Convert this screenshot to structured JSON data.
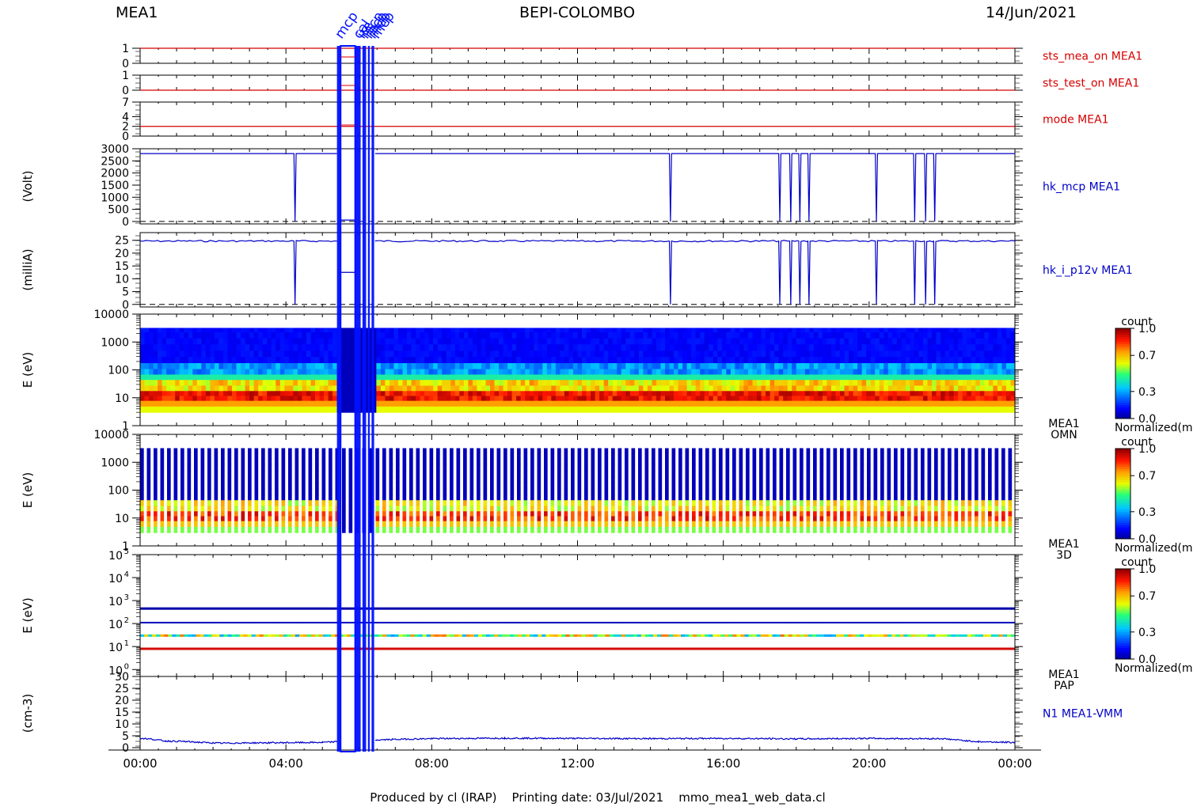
{
  "header": {
    "left": "MEA1",
    "center": "BEPI-COLOMBO",
    "right": "14/Jun/2021"
  },
  "footer": "Produced by cl (IRAP)    Printing date: 03/Jul/2021    mmo_mea1_web_data.cl",
  "time_ticks": [
    "00:00",
    "04:00",
    "08:00",
    "12:00",
    "16:00",
    "20:00",
    "00:00"
  ],
  "top_annotations": [
    "mcp",
    "cal",
    "ite",
    "mcp",
    "mcp",
    "mcp",
    "mcp"
  ],
  "colors": {
    "red": "#d40000",
    "blue": "#0000c8",
    "bright_blue": "#0010ff",
    "frame": "#000000"
  },
  "chart_data": [
    {
      "type": "line",
      "panel": "sts_mea_on",
      "label": "sts_mea_on MEA1",
      "ylabel": "",
      "yticks": [
        "1",
        "0"
      ],
      "ylim": [
        0,
        1
      ],
      "series": [
        {
          "color": "#d40000",
          "x": [
            0,
            24
          ],
          "y": [
            1,
            1
          ]
        }
      ]
    },
    {
      "type": "line",
      "panel": "sts_test_on",
      "label": "sts_test_on MEA1",
      "ylabel": "",
      "yticks": [
        "1",
        "0"
      ],
      "ylim": [
        0,
        1
      ],
      "series": [
        {
          "color": "#d40000",
          "x": [
            0,
            24
          ],
          "y": [
            0,
            0
          ]
        }
      ]
    },
    {
      "type": "line",
      "panel": "mode",
      "label": "mode MEA1",
      "ylabel": "",
      "yticks": [
        "7",
        "4",
        "2",
        "0"
      ],
      "ylim": [
        0,
        7
      ],
      "series": [
        {
          "color": "#d40000",
          "x": [
            0,
            24
          ],
          "y": [
            2,
            2
          ]
        }
      ]
    },
    {
      "type": "line",
      "panel": "hk_mcp",
      "label": "hk_mcp MEA1",
      "ylabel": "(Volt)",
      "yticks": [
        "3000",
        "2500",
        "2000",
        "1500",
        "1000",
        "500",
        "0"
      ],
      "ylim": [
        -100,
        3000
      ],
      "dips_hours": [
        4.25,
        14.55,
        17.55,
        17.85,
        18.1,
        18.35,
        20.2,
        21.25,
        21.55,
        21.8
      ],
      "series": [
        {
          "color": "#0000c8",
          "x": [
            0,
            5.4
          ],
          "y": [
            2800,
            2800
          ]
        },
        {
          "color": "#0000c8",
          "x": [
            5.45,
            5.9
          ],
          "y": [
            60,
            60
          ]
        },
        {
          "color": "#0000c8",
          "x": [
            6.45,
            24
          ],
          "y": [
            2800,
            2800
          ]
        }
      ]
    },
    {
      "type": "line",
      "panel": "hk_i_p12v",
      "label": "hk_i_p12v MEA1",
      "ylabel": "(milliA)",
      "yticks": [
        "25",
        "20",
        "15",
        "10",
        "5",
        "0"
      ],
      "ylim": [
        -1,
        28
      ],
      "dips_hours": [
        4.25,
        14.55,
        17.55,
        17.85,
        18.1,
        18.35,
        20.2,
        21.25,
        21.55,
        21.8
      ],
      "series": [
        {
          "color": "#0000c8",
          "x": [
            0,
            5.4
          ],
          "y": [
            24.7,
            24.7
          ]
        },
        {
          "color": "#0000c8",
          "x": [
            5.45,
            5.9
          ],
          "y": [
            12.5,
            12.5
          ]
        },
        {
          "color": "#0000c8",
          "x": [
            6.45,
            24
          ],
          "y": [
            24.7,
            24.7
          ]
        }
      ]
    },
    {
      "type": "heatmap",
      "panel": "omn",
      "label": [
        "MEA1",
        "OMN"
      ],
      "ylabel": "E (eV)",
      "yticks": [
        "10000",
        "1000",
        "100",
        "10",
        "1"
      ],
      "ylog": true,
      "ylim": [
        1,
        10000
      ],
      "colorbar": {
        "title": "count",
        "ticks": [
          "1.0",
          "0.7",
          "0.3",
          "0.0"
        ],
        "label": "Normalized(m"
      }
    },
    {
      "type": "heatmap",
      "panel": "3d",
      "label": [
        "MEA1",
        "3D"
      ],
      "ylabel": "E (eV)",
      "yticks": [
        "10000",
        "1000",
        "100",
        "10",
        "1"
      ],
      "ylog": true,
      "ylim": [
        1,
        10000
      ],
      "colorbar": {
        "title": "count",
        "ticks": [
          "1.0",
          "0.7",
          "0.3",
          "0.0"
        ],
        "label": "Normalized(m"
      }
    },
    {
      "type": "heatmap",
      "panel": "pap",
      "label": [
        "MEA1",
        "PAP"
      ],
      "ylabel": "E (eV)",
      "yticks_exp": [
        "5",
        "4",
        "3",
        "2",
        "1",
        "0"
      ],
      "ytick_base": "10",
      "ylog": true,
      "ylim": [
        0.5,
        100000
      ],
      "colorbar": {
        "title": "count",
        "ticks": [
          "1.0",
          "0.7",
          "0.3",
          "0.0"
        ],
        "label": "Normalized(m"
      }
    },
    {
      "type": "line",
      "panel": "n1",
      "label": "N1 MEA1-VMM",
      "ylabel": "(cm-3)",
      "yticks": [
        "30",
        "25",
        "20",
        "15",
        "10",
        "5",
        "0"
      ],
      "ylim": [
        -1,
        30
      ],
      "series": [
        {
          "color": "#0000c8",
          "x": [
            0,
            0.3,
            0.7,
            1.2,
            1.7,
            2.2,
            3,
            4,
            5,
            5.4,
            6.45,
            7,
            8,
            9,
            10,
            12,
            14,
            16,
            17,
            18,
            20,
            21,
            22,
            23,
            24
          ],
          "y": [
            4,
            3.6,
            2.8,
            2.6,
            2.2,
            1.9,
            2,
            2.1,
            2.2,
            2.5,
            3.2,
            3.5,
            3.8,
            3.9,
            4,
            3.9,
            3.8,
            3.9,
            3.8,
            3.7,
            3.9,
            3.8,
            3.8,
            2.5,
            2.2
          ]
        }
      ]
    }
  ]
}
